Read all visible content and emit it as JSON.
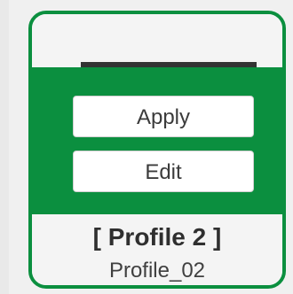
{
  "profile_card": {
    "apply_label": "Apply",
    "edit_label": "Edit",
    "title": "[ Profile 2 ]",
    "subtitle": "Profile_02",
    "accent_color": "#0b8f3f"
  }
}
